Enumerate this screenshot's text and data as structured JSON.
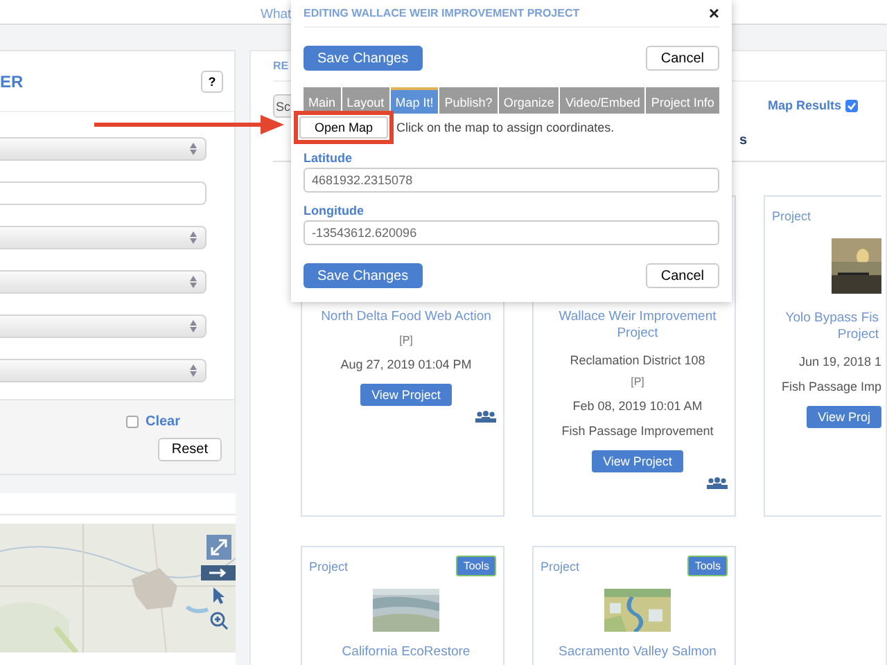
{
  "top_nav": {
    "link": "What"
  },
  "filter_panel": {
    "title": "ER",
    "help": "?",
    "fields": [
      {
        "kind": "select"
      },
      {
        "kind": "text"
      },
      {
        "kind": "select"
      },
      {
        "kind": "select"
      },
      {
        "kind": "select"
      },
      {
        "kind": "select"
      }
    ],
    "clear": {
      "label": "Clear",
      "checked": false
    },
    "reset": "Reset"
  },
  "results": {
    "heading": "RE",
    "sort_select": "Sc",
    "tab_fragment": "s",
    "map_results": {
      "label": "Map Results",
      "checked": true
    }
  },
  "cards": [
    {
      "lines": [
        {
          "kind": "title",
          "text": "North Delta Food Web Action"
        },
        {
          "kind": "tag",
          "text": "[P]"
        },
        {
          "kind": "info",
          "text": "Aug 27, 2019 01:04 PM"
        }
      ],
      "button": "View Project",
      "team": true
    },
    {
      "lines": [
        {
          "kind": "title",
          "text": "Wallace Weir Improvement Project"
        },
        {
          "kind": "info",
          "text": "Reclamation District 108"
        },
        {
          "kind": "tag",
          "text": "[P]"
        },
        {
          "kind": "info",
          "text": "Feb 08, 2019 10:01 AM"
        },
        {
          "kind": "info",
          "text": "Fish Passage Improvement"
        }
      ],
      "button": "View Project",
      "team": true
    },
    {
      "label": "Project",
      "lines": [
        {
          "kind": "title",
          "text": "Yolo Bypass Fis"
        },
        {
          "kind": "title",
          "text": "Project"
        },
        {
          "kind": "info",
          "text": "Jun 19, 2018 1"
        },
        {
          "kind": "info",
          "text": "Fish Passage Imp"
        }
      ],
      "button": "View Proj",
      "team": false
    },
    {
      "label": "Project",
      "tools": "Tools",
      "lines": [
        {
          "kind": "title",
          "text": "California EcoRestore"
        }
      ],
      "team": false
    },
    {
      "label": "Project",
      "tools": "Tools",
      "lines": [
        {
          "kind": "title",
          "text": "Sacramento Valley Salmon"
        }
      ],
      "team": false
    }
  ],
  "modal": {
    "title": "EDITING WALLACE WEIR IMPROVEMENT PROJECT",
    "close": "×",
    "top_buttons": {
      "save": "Save Changes",
      "cancel": "Cancel"
    },
    "tabs": [
      {
        "label": "Main",
        "selected": false
      },
      {
        "label": "Layout",
        "selected": false
      },
      {
        "label": "Map It!",
        "selected": true
      },
      {
        "label": "Publish?",
        "selected": false
      },
      {
        "label": "Organize",
        "selected": false
      },
      {
        "label": "Video/Embed",
        "selected": false
      },
      {
        "label": "Project Info",
        "selected": false
      }
    ],
    "open_map": "Open Map",
    "hint": "Click on the map to assign coordinates.",
    "fields": [
      {
        "label": "Latitude",
        "value": "4681932.2315078"
      },
      {
        "label": "Longitude",
        "value": "-13543612.620096"
      }
    ],
    "bottom_buttons": {
      "save": "Save Changes",
      "cancel": "Cancel"
    }
  }
}
